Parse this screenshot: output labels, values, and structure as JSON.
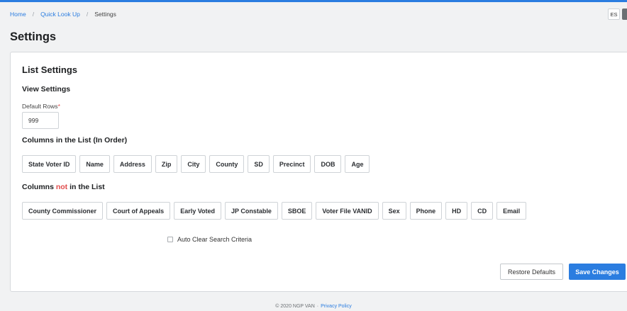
{
  "colors": {
    "accent": "#2b7de0",
    "required": "#e14b4b",
    "page_bg": "#f1f2f3"
  },
  "breadcrumb": {
    "items": [
      "Home",
      "Quick Look Up"
    ],
    "separator": "/",
    "current": "Settings"
  },
  "header": {
    "language": "ES",
    "user_icon": "user-icon"
  },
  "page": {
    "title": "Settings"
  },
  "card": {
    "title": "List Settings",
    "view_settings": {
      "title": "View Settings",
      "default_rows_label": "Default Rows",
      "required_marker": "*",
      "default_rows_value": "999"
    },
    "columns_in": {
      "title": "Columns in the List (In Order)",
      "items": [
        "State Voter ID",
        "Name",
        "Address",
        "Zip",
        "City",
        "County",
        "SD",
        "Precinct",
        "DOB",
        "Age"
      ]
    },
    "columns_not": {
      "title_prefix": "Columns",
      "title_not": "not",
      "title_suffix": "in the List",
      "items": [
        "County Commissioner",
        "Court of Appeals",
        "Early Voted",
        "JP Constable",
        "SBOE",
        "Voter File VANID",
        "Sex",
        "Phone",
        "HD",
        "CD",
        "Email"
      ]
    },
    "auto_clear": {
      "label": "Auto Clear Search Criteria",
      "checked": false
    },
    "buttons": {
      "restore": "Restore Defaults",
      "save": "Save Changes"
    }
  },
  "footer": {
    "copyright": "© 2020 NGP VAN",
    "separator": "·",
    "privacy": "Privacy Policy"
  }
}
